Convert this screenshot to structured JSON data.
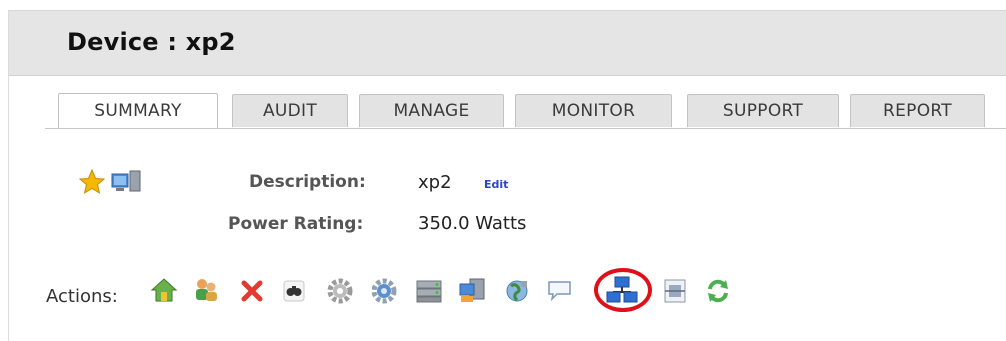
{
  "page": {
    "title": "Device : xp2"
  },
  "tabs": [
    {
      "label": "SUMMARY",
      "active": true
    },
    {
      "label": "AUDIT",
      "active": false
    },
    {
      "label": "MANAGE",
      "active": false
    },
    {
      "label": "MONITOR",
      "active": false
    },
    {
      "label": "SUPPORT",
      "active": false
    },
    {
      "label": "REPORT",
      "active": false
    }
  ],
  "device_icons": [
    "star-icon",
    "computer-icon"
  ],
  "details": {
    "description_label": "Description:",
    "description_value": "xp2",
    "edit_label": "Edit",
    "power_label": "Power Rating:",
    "power_value": "350.0 Watts"
  },
  "actions": {
    "label": "Actions:",
    "icons": [
      "home-icon",
      "user-group-icon",
      "delete-x-icon",
      "binoculars-icon",
      "gear-icon",
      "gear-globe-icon",
      "server-icon",
      "computer-connect-icon",
      "globe-icon",
      "chat-bubble-icon",
      "network-icon",
      "scan-icon",
      "refresh-icon"
    ],
    "highlighted": "network-icon",
    "highlight_color": "#e0101a"
  }
}
